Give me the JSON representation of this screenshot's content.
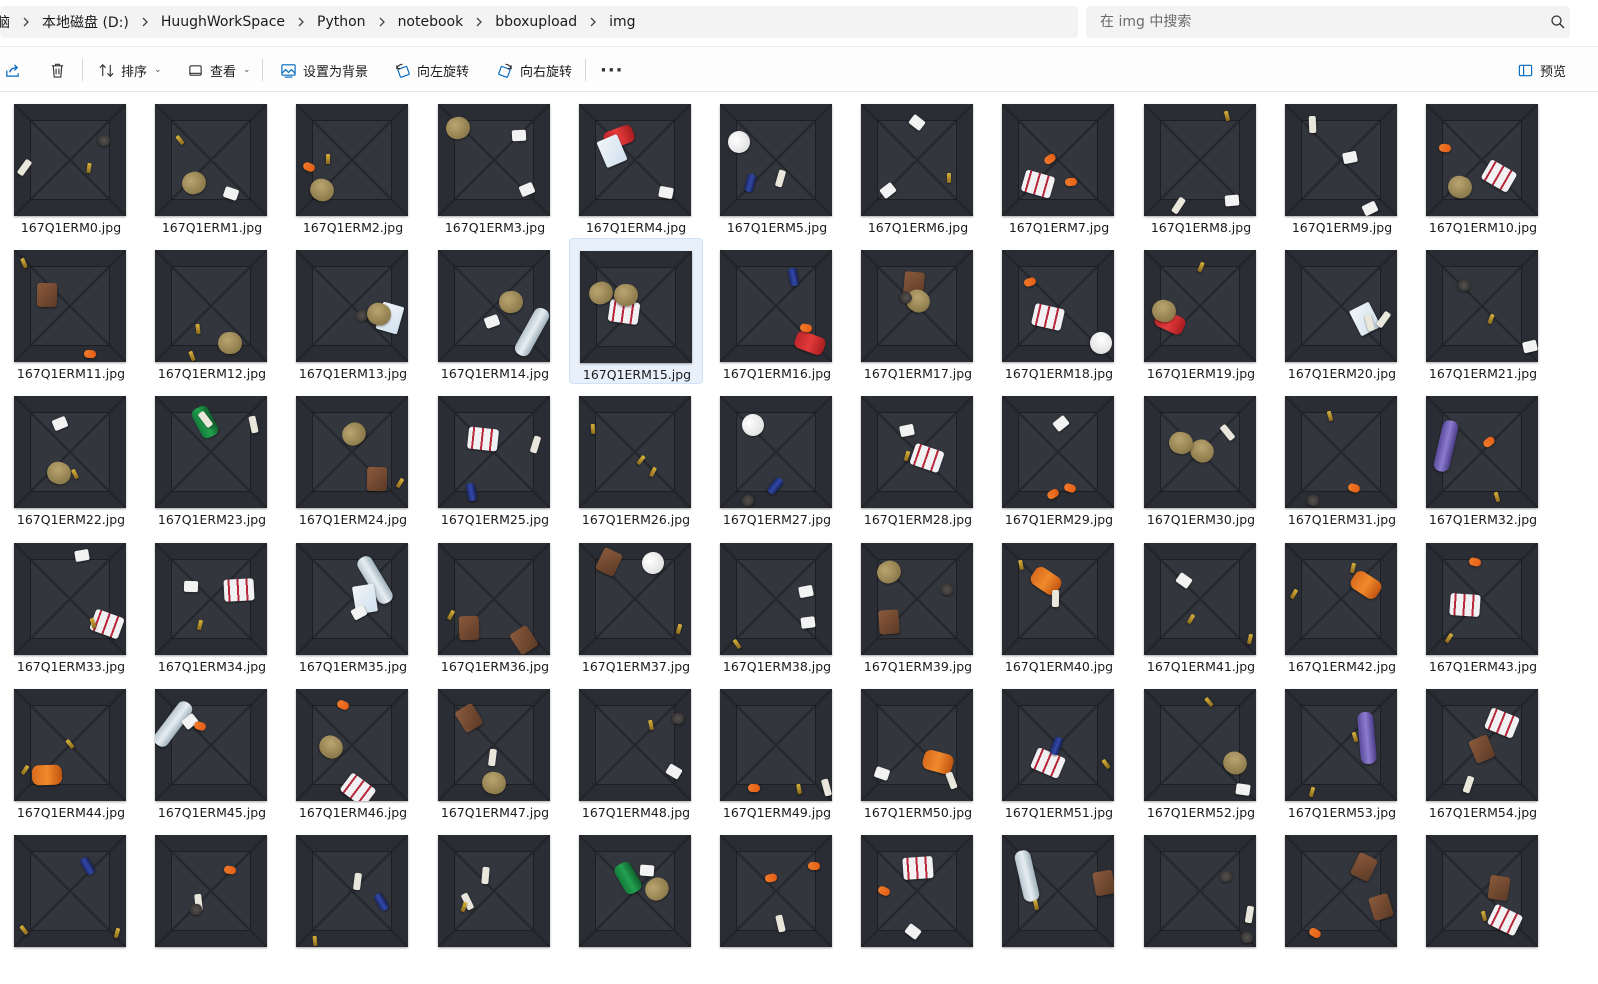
{
  "breadcrumb": [
    "脑",
    "本地磁盘 (D:)",
    "HuughWorkSpace",
    "Python",
    "notebook",
    "bboxupload",
    "img"
  ],
  "search": {
    "placeholder": "在 img 中搜索"
  },
  "toolbar": {
    "sort_label": "排序",
    "view_label": "查看",
    "set_background_label": "设置为背景",
    "rotate_left_label": "向左旋转",
    "rotate_right_label": "向右旋转",
    "more_label": "···",
    "preview_label": "预览"
  },
  "colors": {
    "accent": "#0067c0",
    "selected_bg": "#e8f1fb",
    "thumb_bg": "#2a2d33"
  },
  "files": [
    "167Q1ERM0.jpg",
    "167Q1ERM1.jpg",
    "167Q1ERM2.jpg",
    "167Q1ERM3.jpg",
    "167Q1ERM4.jpg",
    "167Q1ERM5.jpg",
    "167Q1ERM6.jpg",
    "167Q1ERM7.jpg",
    "167Q1ERM8.jpg",
    "167Q1ERM9.jpg",
    "167Q1ERM10.jpg",
    "167Q1ERM11.jpg",
    "167Q1ERM12.jpg",
    "167Q1ERM13.jpg",
    "167Q1ERM14.jpg",
    "167Q1ERM15.jpg",
    "167Q1ERM16.jpg",
    "167Q1ERM17.jpg",
    "167Q1ERM18.jpg",
    "167Q1ERM19.jpg",
    "167Q1ERM20.jpg",
    "167Q1ERM21.jpg",
    "167Q1ERM22.jpg",
    "167Q1ERM23.jpg",
    "167Q1ERM24.jpg",
    "167Q1ERM25.jpg",
    "167Q1ERM26.jpg",
    "167Q1ERM27.jpg",
    "167Q1ERM28.jpg",
    "167Q1ERM29.jpg",
    "167Q1ERM30.jpg",
    "167Q1ERM31.jpg",
    "167Q1ERM32.jpg",
    "167Q1ERM33.jpg",
    "167Q1ERM34.jpg",
    "167Q1ERM35.jpg",
    "167Q1ERM36.jpg",
    "167Q1ERM37.jpg",
    "167Q1ERM38.jpg",
    "167Q1ERM39.jpg",
    "167Q1ERM40.jpg",
    "167Q1ERM41.jpg",
    "167Q1ERM42.jpg",
    "167Q1ERM43.jpg",
    "167Q1ERM44.jpg",
    "167Q1ERM45.jpg",
    "167Q1ERM46.jpg",
    "167Q1ERM47.jpg",
    "167Q1ERM48.jpg",
    "167Q1ERM49.jpg",
    "167Q1ERM50.jpg",
    "167Q1ERM51.jpg",
    "167Q1ERM52.jpg",
    "167Q1ERM53.jpg",
    "167Q1ERM54.jpg"
  ],
  "selected_file": "167Q1ERM15.jpg",
  "thumb_objects": [
    [
      "white-bar",
      "dark-rock",
      "battery"
    ],
    [
      "paper",
      "potato",
      "battery"
    ],
    [
      "potato",
      "battery",
      "carrot"
    ],
    [
      "paper",
      "potato",
      "paper"
    ],
    [
      "red-can",
      "milk-box",
      "paper"
    ],
    [
      "white-ball",
      "blue-can",
      "white-bar"
    ],
    [
      "paper",
      "paper",
      "battery"
    ],
    [
      "pill-pack",
      "carrot",
      "carrot"
    ],
    [
      "white-bar",
      "paper",
      "battery"
    ],
    [
      "paper",
      "paper",
      "white-bar"
    ],
    [
      "pill-pack",
      "potato",
      "carrot"
    ],
    [
      "brick",
      "carrot",
      "battery"
    ],
    [
      "battery",
      "potato",
      "battery"
    ],
    [
      "milk-box",
      "dark-rock",
      "potato"
    ],
    [
      "bottle",
      "potato",
      "paper"
    ],
    [
      "pill-pack",
      "potato",
      "potato"
    ],
    [
      "red-can",
      "blue-can",
      "carrot"
    ],
    [
      "brick",
      "potato",
      "dark-rock"
    ],
    [
      "pill-pack",
      "white-ball",
      "carrot"
    ],
    [
      "red-can",
      "potato",
      "battery"
    ],
    [
      "milk-box",
      "white-bar",
      "white-bar"
    ],
    [
      "paper",
      "dark-rock",
      "battery"
    ],
    [
      "potato",
      "paper",
      "battery"
    ],
    [
      "green-can",
      "white-bar",
      "white-bar"
    ],
    [
      "brick",
      "potato",
      "battery"
    ],
    [
      "pill-pack",
      "blue-can",
      "white-bar"
    ],
    [
      "battery",
      "battery",
      "battery"
    ],
    [
      "blue-can",
      "white-ball",
      "dark-rock"
    ],
    [
      "pill-pack",
      "paper",
      "battery"
    ],
    [
      "carrot",
      "paper",
      "carrot"
    ],
    [
      "potato",
      "potato",
      "white-bar"
    ],
    [
      "dark-rock",
      "carrot",
      "battery"
    ],
    [
      "bottle-purple",
      "carrot",
      "battery"
    ],
    [
      "pill-pack",
      "paper",
      "battery"
    ],
    [
      "pill-pack",
      "paper",
      "battery"
    ],
    [
      "bottle",
      "milk-box",
      "paper"
    ],
    [
      "brick",
      "brick",
      "battery"
    ],
    [
      "brick",
      "white-ball",
      "battery"
    ],
    [
      "paper",
      "paper",
      "battery"
    ],
    [
      "brick",
      "potato",
      "dark-rock"
    ],
    [
      "orange-can",
      "white-bar",
      "battery"
    ],
    [
      "paper",
      "battery",
      "battery"
    ],
    [
      "orange-can",
      "battery",
      "battery"
    ],
    [
      "pill-pack",
      "carrot",
      "battery"
    ],
    [
      "orange-can",
      "battery",
      "battery"
    ],
    [
      "bottle",
      "paper",
      "carrot"
    ],
    [
      "pill-pack",
      "carrot",
      "potato"
    ],
    [
      "brick",
      "potato",
      "white-bar"
    ],
    [
      "paper",
      "dark-rock",
      "battery"
    ],
    [
      "battery",
      "white-bar",
      "carrot"
    ],
    [
      "orange-can",
      "white-bar",
      "paper"
    ],
    [
      "pill-pack",
      "blue-can",
      "battery"
    ],
    [
      "potato",
      "paper",
      "battery"
    ],
    [
      "bottle-purple",
      "battery",
      "battery"
    ],
    [
      "pill-pack",
      "brick",
      "white-bar"
    ]
  ],
  "bottom_row_objects": [
    [
      "battery",
      "blue-can",
      "battery"
    ],
    [
      "carrot",
      "white-bar",
      "dark-rock"
    ],
    [
      "white-bar",
      "blue-can",
      "battery"
    ],
    [
      "white-bar",
      "white-bar",
      "battery"
    ],
    [
      "green-can",
      "potato",
      "paper"
    ],
    [
      "white-bar",
      "carrot",
      "carrot"
    ],
    [
      "pill-pack",
      "carrot",
      "paper"
    ],
    [
      "bottle",
      "brick",
      "battery"
    ],
    [
      "dark-rock",
      "white-bar",
      "dark-rock"
    ],
    [
      "brick",
      "carrot",
      "brick"
    ],
    [
      "pill-pack",
      "brick",
      "battery"
    ]
  ]
}
